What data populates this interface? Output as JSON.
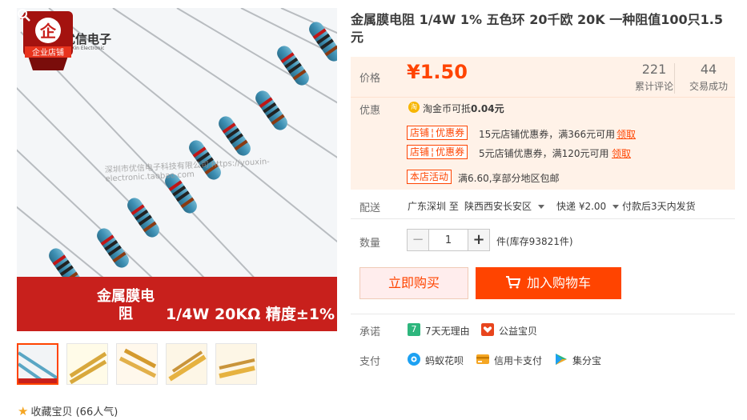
{
  "product": {
    "title": "金属膜电阻 1/4W 1% 五色环 20千欧 20K 一种阻值100只1.5元"
  },
  "gallery": {
    "logo_text": "优信电子",
    "logo_sub": "YouXin Electronic",
    "watermark": "深圳市优信电子科技有限公司 https://youxin-electronic.taobao.com",
    "badge_text": "企业店铺",
    "banner_category": "金属膜电阻",
    "banner_spec": "1/4W 20KΩ 精度±1%",
    "thumb_count": 5
  },
  "favorite": {
    "label": "收藏宝贝",
    "popularity": "(66人气)"
  },
  "price": {
    "label": "价格",
    "currency": "¥",
    "value": "1.50",
    "reviews_count": "221",
    "reviews_label": "累计评论",
    "sales_count": "44",
    "sales_label": "交易成功"
  },
  "promo": {
    "label": "优惠",
    "coin_icon": "淘",
    "coin_text": "淘金币可抵",
    "coin_value": "0.04元",
    "coupons": [
      {
        "tag_a": "店铺",
        "tag_b": "优惠券",
        "text": "15元店铺优惠券，满366元可用",
        "link": "领取"
      },
      {
        "tag_a": "店铺",
        "tag_b": "优惠券",
        "text": "5元店铺优惠券，满120元可用",
        "link": "领取"
      }
    ],
    "activity_tag": "本店活动",
    "activity_text": "满6.60,享部分地区包邮"
  },
  "shipping": {
    "label": "配送",
    "from": "广东深圳 至",
    "to": "陕西西安长安区",
    "method": "快递 ¥2.00",
    "timing": "付款后3天内发货"
  },
  "quantity": {
    "label": "数量",
    "minus": "−",
    "value": "1",
    "plus": "+",
    "stock": "件(库存93821件)"
  },
  "actions": {
    "buy_now": "立即购买",
    "add_cart": "加入购物车"
  },
  "promise": {
    "label": "承诺",
    "items": [
      {
        "icon": "7",
        "text": "7天无理由"
      },
      {
        "icon": "heart",
        "text": "公益宝贝"
      }
    ]
  },
  "payment": {
    "label": "支付",
    "items": [
      {
        "icon": "huabei",
        "text": "蚂蚁花呗"
      },
      {
        "icon": "card",
        "text": "信用卡支付"
      },
      {
        "icon": "jifen",
        "text": "集分宝"
      }
    ]
  },
  "colors": {
    "accent": "#ff4400",
    "price_bg": "#fff2e8",
    "banner_red": "#c8201c"
  }
}
